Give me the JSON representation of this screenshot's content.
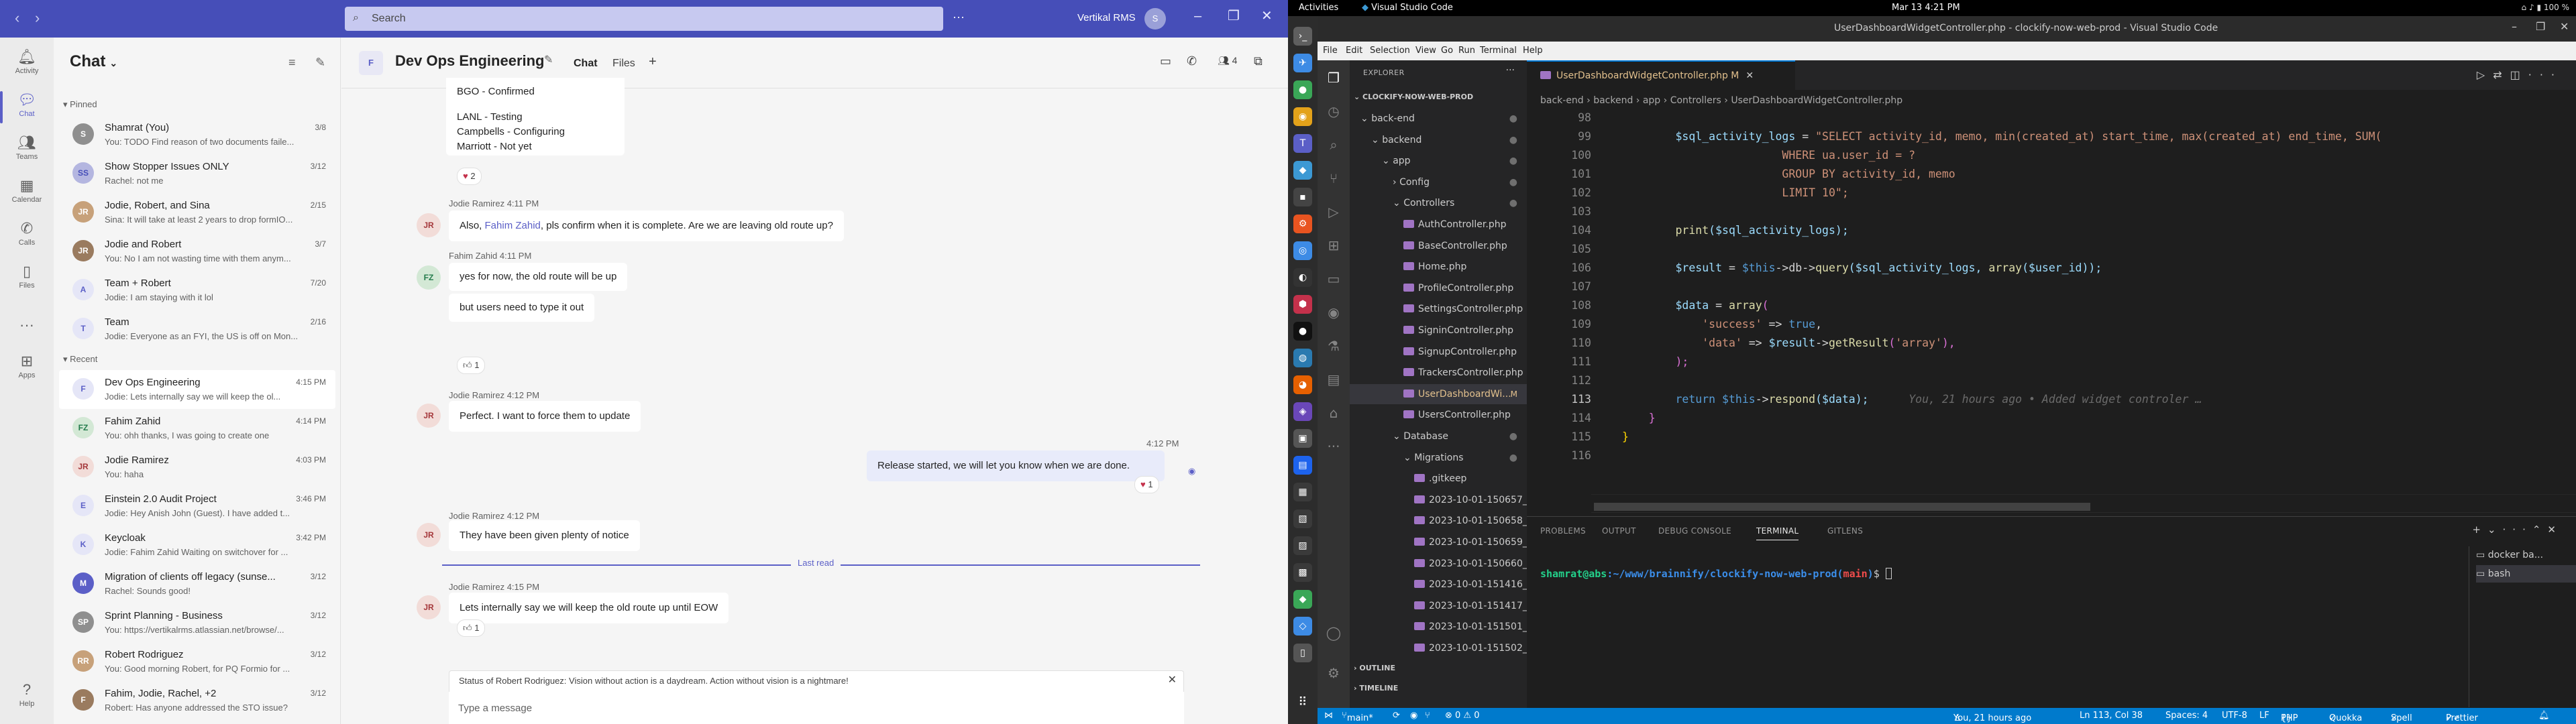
{
  "teams": {
    "top": {
      "search_placeholder": "Search",
      "org": "Vertikal RMS"
    },
    "rail": [
      {
        "label": "Activity",
        "icon": "bell-icon"
      },
      {
        "label": "Chat",
        "icon": "chat-icon"
      },
      {
        "label": "Teams",
        "icon": "teams-icon"
      },
      {
        "label": "Calendar",
        "icon": "calendar-icon"
      },
      {
        "label": "Calls",
        "icon": "phone-icon"
      },
      {
        "label": "Files",
        "icon": "file-icon"
      },
      {
        "label": "Apps",
        "icon": "apps-icon"
      },
      {
        "label": "Help",
        "icon": "help-icon"
      }
    ],
    "chatlist": {
      "title": "Chat",
      "pinned_label": "Pinned",
      "recent_label": "Recent",
      "pinned": [
        {
          "name": "Shamrat (You)",
          "time": "3/8",
          "preview": "You: TODO Find reason of two documents faile..."
        },
        {
          "name": "Show Stopper Issues ONLY",
          "time": "3/12",
          "preview": "Rachel: not me"
        },
        {
          "name": "Jodie, Robert, and Sina",
          "time": "2/15",
          "preview": "Sina: It will take at least 2 years to drop formIO..."
        },
        {
          "name": "Jodie and Robert",
          "time": "3/7",
          "preview": "You: No I am not wasting time with them anym..."
        },
        {
          "name": "Team + Robert",
          "time": "7/20",
          "preview": "Jodie: I am staying with it lol"
        },
        {
          "name": "Team",
          "time": "2/16",
          "preview": "Jodie: Everyone as an FYI, the US is off on Mon..."
        }
      ],
      "recent": [
        {
          "name": "Dev Ops Engineering",
          "time": "4:15 PM",
          "preview": "Jodie: Lets internally say we will keep the ol..."
        },
        {
          "name": "Fahim Zahid",
          "time": "4:14 PM",
          "preview": "You: ohh thanks, I was going to create one"
        },
        {
          "name": "Jodie Ramirez",
          "time": "4:03 PM",
          "preview": "You: haha"
        },
        {
          "name": "Einstein 2.0 Audit Project",
          "time": "3:46 PM",
          "preview": "Jodie: Hey Anish John (Guest). I have added t..."
        },
        {
          "name": "Keycloak",
          "time": "3:42 PM",
          "preview": "Jodie: Fahim Zahid Waiting on switchover for ..."
        },
        {
          "name": "Migration of clients off legacy (sunse...",
          "time": "3/12",
          "preview": "Rachel: Sounds good!"
        },
        {
          "name": "Sprint Planning - Business",
          "time": "3/12",
          "preview": "You: https://vertikalrms.atlassian.net/browse/..."
        },
        {
          "name": "Robert Rodriguez",
          "time": "3/12",
          "preview": "You: Good morning Robert, for PQ Formio for ..."
        },
        {
          "name": "Fahim, Jodie, Rachel, +2",
          "time": "3/12",
          "preview": "Robert: Has anyone addressed the STO issue?"
        }
      ]
    },
    "chat": {
      "title": "Dev Ops Engineering",
      "tab_chat": "Chat",
      "tab_files": "Files",
      "people_count": "4",
      "m0_lines": [
        "BGO - Confirmed",
        "LANL - Testing",
        "Campbells - Configuring",
        "Marriott - Not yet"
      ],
      "m0_react": "2",
      "m1_meta": "Jodie Ramirez  4:11 PM",
      "m1_pre": "Also, ",
      "m1_link": "Fahim Zahid",
      "m1_post": ", pls confirm when it is complete.  Are we are leaving old route up?",
      "m2_meta": "Fahim Zahid  4:11 PM",
      "m2_text": "yes for now, the old route will be up",
      "m3_text": "but users need to type it out",
      "m3_react": "1",
      "m4_meta": "Jodie Ramirez  4:12 PM",
      "m4_text": "Perfect.  I want to force them to update",
      "m5_time": "4:12 PM",
      "m5_text": "Release started, we will let you know when we are done.",
      "m5_react": "1",
      "m6_meta": "Jodie Ramirez  4:12 PM",
      "m6_text": "They have been given plenty of notice",
      "last_read": "Last read",
      "m7_meta": "Jodie Ramirez  4:15 PM",
      "m7_text": "Lets internally say we will keep the old route up until EOW",
      "m7_react": "1",
      "status_text": "Status of Robert Rodriguez: Vision without action is a daydream. Action without vision is a nightmare!",
      "compose_placeholder": "Type a message"
    }
  },
  "ubuntu": {
    "activities": "Activities",
    "app_name": "Visual Studio Code",
    "clock": "Mar 13  4:21 PM",
    "battery": "100 %"
  },
  "vscode": {
    "title": "UserDashboardWidgetController.php - clockify-now-web-prod - Visual Studio Code",
    "menu": [
      "File",
      "Edit",
      "Selection",
      "View",
      "Go",
      "Run",
      "Terminal",
      "Help"
    ],
    "explorer_label": "EXPLORER",
    "root": "CLOCKIFY-NOW-WEB-PROD",
    "tree": [
      {
        "d": 1,
        "type": "folder",
        "open": true,
        "label": "back-end"
      },
      {
        "d": 2,
        "type": "folder",
        "open": true,
        "label": "backend"
      },
      {
        "d": 3,
        "type": "folder",
        "open": true,
        "label": "app"
      },
      {
        "d": 4,
        "type": "folder",
        "open": false,
        "label": "Config"
      },
      {
        "d": 4,
        "type": "folder",
        "open": true,
        "label": "Controllers"
      },
      {
        "d": 5,
        "type": "file",
        "label": "AuthController.php"
      },
      {
        "d": 5,
        "type": "file",
        "label": "BaseController.php"
      },
      {
        "d": 5,
        "type": "file",
        "label": "Home.php"
      },
      {
        "d": 5,
        "type": "file",
        "label": "ProfileController.php"
      },
      {
        "d": 5,
        "type": "file",
        "label": "SettingsController.php"
      },
      {
        "d": 5,
        "type": "file",
        "label": "SigninController.php"
      },
      {
        "d": 5,
        "type": "file",
        "label": "SignupController.php"
      },
      {
        "d": 5,
        "type": "file",
        "label": "TrackersController.php"
      },
      {
        "d": 5,
        "type": "file",
        "label": "UserDashboardWi...",
        "mark": "M",
        "sel": true
      },
      {
        "d": 5,
        "type": "file",
        "label": "UsersController.php"
      },
      {
        "d": 4,
        "type": "folder",
        "open": true,
        "label": "Database"
      },
      {
        "d": 5,
        "type": "folder",
        "open": true,
        "label": "Migrations"
      },
      {
        "d": 6,
        "type": "file",
        "label": ".gitkeep"
      },
      {
        "d": 6,
        "type": "file",
        "label": "2023-10-01-150657_C..."
      },
      {
        "d": 6,
        "type": "file",
        "label": "2023-10-01-150658_C..."
      },
      {
        "d": 6,
        "type": "file",
        "label": "2023-10-01-150659_C..."
      },
      {
        "d": 6,
        "type": "file",
        "label": "2023-10-01-150660_C..."
      },
      {
        "d": 6,
        "type": "file",
        "label": "2023-10-01-151416_C..."
      },
      {
        "d": 6,
        "type": "file",
        "label": "2023-10-01-151417_C..."
      },
      {
        "d": 6,
        "type": "file",
        "label": "2023-10-01-151501_C..."
      },
      {
        "d": 6,
        "type": "file",
        "label": "2023-10-01-151502_C..."
      }
    ],
    "outline": "OUTLINE",
    "timeline": "TIMELINE",
    "tab": "UserDashboardWidgetController.php",
    "tab_mark": "M",
    "breadcrumb": "back-end  ›  backend  ›  app  ›  Controllers  ›  UserDashboardWidgetController.php",
    "lines": [
      "98",
      "99",
      "100",
      "101",
      "102",
      "103",
      "104",
      "105",
      "106",
      "107",
      "108",
      "109",
      "110",
      "111",
      "112",
      "113",
      "114",
      "115",
      "116"
    ],
    "code": {
      "l99_a": "        $sql_activity_logs",
      "l99_b": " = ",
      "l99_c": "\"SELECT activity_id, memo, min(created_at) start_time, max(created_at) end_time, SUM(",
      "l100": "                        WHERE ua.user_id = ?",
      "l101": "                        GROUP BY activity_id, memo",
      "l102": "                        LIMIT 10\";",
      "l104_f": "        print",
      "l104_r": "($sql_activity_logs);",
      "l106_v": "        $result",
      "l106_m": " = ",
      "l106_t": "$this",
      "l106_r": "->db->",
      "l106_f": "query",
      "l106_e": "($sql_activity_logs, ",
      "l106_a": "array",
      "l106_z": "($user_id));",
      "l108_v": "        $data",
      "l108_m": " = ",
      "l108_a": "array",
      "l108_z": "(",
      "l109_s": "            'success'",
      "l109_m": " => ",
      "l109_k": "true",
      "l109_z": ",",
      "l110_s": "            'data'",
      "l110_m": " => ",
      "l110_v": "$result",
      "l110_r": "->",
      "l110_f": "getResult",
      "l110_p": "(",
      "l110_q": "'array'",
      "l110_z": "),",
      "l111": "        );",
      "l113_k": "        return ",
      "l113_t": "$this",
      "l113_r": "->",
      "l113_f": "respond",
      "l113_z": "($data);",
      "l113_blame": "      You, 21 hours ago • Added widget controler …",
      "l114": "    }",
      "l115": "}"
    },
    "panel_tabs": [
      "PROBLEMS",
      "OUTPUT",
      "DEBUG CONSOLE",
      "TERMINAL",
      "GITLENS"
    ],
    "terminal": {
      "user": "shamrat@abs",
      "path": ":~/www/brainnify/clockify-now-web-prod",
      "branch": "main",
      "open": "(",
      "close": ")",
      "end": "$ "
    },
    "shells": [
      "docker ba...",
      "bash"
    ],
    "status": {
      "branch": "main*",
      "errors": "⊗ 0 ⚠ 0",
      "blame": "You, 21 hours ago",
      "position": "Ln 113, Col 38",
      "spaces": "Spaces: 4",
      "encoding": "UTF-8",
      "eol": "LF",
      "lang": "PHP",
      "quokka": "Quokka",
      "spell": "Spell",
      "prettier": "Prettier"
    }
  }
}
